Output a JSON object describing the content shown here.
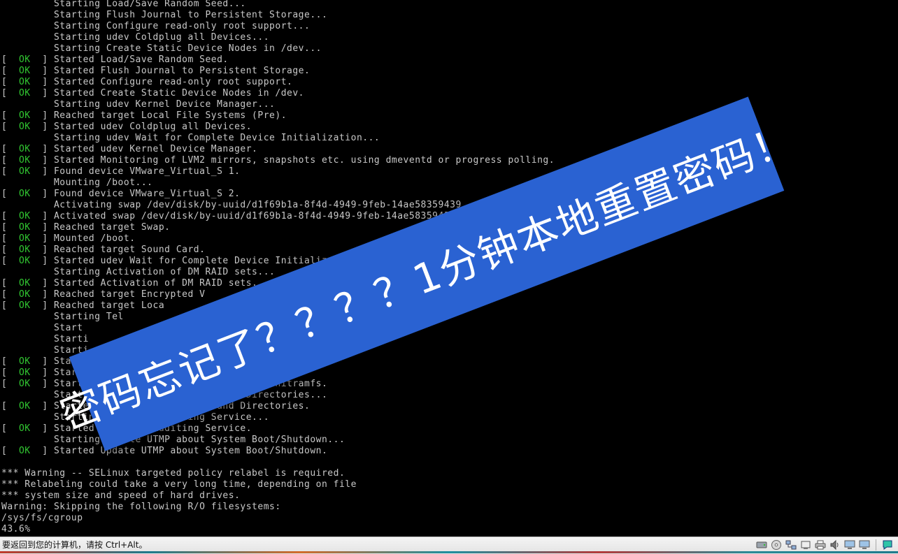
{
  "console": {
    "lines": [
      {
        "ok": false,
        "text": "Starting Load/Save Random Seed..."
      },
      {
        "ok": false,
        "text": "Starting Flush Journal to Persistent Storage..."
      },
      {
        "ok": false,
        "text": "Starting Configure read-only root support..."
      },
      {
        "ok": false,
        "text": "Starting udev Coldplug all Devices..."
      },
      {
        "ok": false,
        "text": "Starting Create Static Device Nodes in /dev..."
      },
      {
        "ok": true,
        "text": "Started Load/Save Random Seed."
      },
      {
        "ok": true,
        "text": "Started Flush Journal to Persistent Storage."
      },
      {
        "ok": true,
        "text": "Started Configure read-only root support."
      },
      {
        "ok": true,
        "text": "Started Create Static Device Nodes in /dev."
      },
      {
        "ok": false,
        "text": "Starting udev Kernel Device Manager..."
      },
      {
        "ok": true,
        "text": "Reached target Local File Systems (Pre)."
      },
      {
        "ok": true,
        "text": "Started udev Coldplug all Devices."
      },
      {
        "ok": false,
        "text": "Starting udev Wait for Complete Device Initialization..."
      },
      {
        "ok": true,
        "text": "Started udev Kernel Device Manager."
      },
      {
        "ok": true,
        "text": "Started Monitoring of LVM2 mirrors, snapshots etc. using dmeventd or progress polling."
      },
      {
        "ok": true,
        "text": "Found device VMware_Virtual_S 1."
      },
      {
        "ok": false,
        "text": "Mounting /boot..."
      },
      {
        "ok": true,
        "text": "Found device VMware_Virtual_S 2."
      },
      {
        "ok": false,
        "text": "Activating swap /dev/disk/by-uuid/d1f69b1a-8f4d-4949-9feb-14ae58359439..."
      },
      {
        "ok": true,
        "text": "Activated swap /dev/disk/by-uuid/d1f69b1a-8f4d-4949-9feb-14ae58359439."
      },
      {
        "ok": true,
        "text": "Reached target Swap."
      },
      {
        "ok": true,
        "text": "Mounted /boot."
      },
      {
        "ok": true,
        "text": "Reached target Sound Card."
      },
      {
        "ok": true,
        "text": "Started udev Wait for Complete Device Initializa"
      },
      {
        "ok": false,
        "text": "Starting Activation of DM RAID sets..."
      },
      {
        "ok": true,
        "text": "Started Activation of DM RAID sets."
      },
      {
        "ok": true,
        "text": "Reached target Encrypted V"
      },
      {
        "ok": true,
        "text": "Reached target Loca"
      },
      {
        "ok": false,
        "text": "Starting Tel"
      },
      {
        "ok": false,
        "text": "Start"
      },
      {
        "ok": false,
        "text": "Starti"
      },
      {
        "ok": false,
        "text": "Starti"
      },
      {
        "ok": true,
        "text": "Started"
      },
      {
        "ok": true,
        "text": "Started                     ime Data."
      },
      {
        "ok": true,
        "text": "Started                   ation from initramfs."
      },
      {
        "ok": false,
        "text": "Starting               Files and Directories..."
      },
      {
        "ok": true,
        "text": "Started C      latile Files and Directories."
      },
      {
        "ok": false,
        "text": "Starting Security Auditing Service..."
      },
      {
        "ok": true,
        "text": "Started Security Auditing Service."
      },
      {
        "ok": false,
        "text": "Starting Update UTMP about System Boot/Shutdown..."
      },
      {
        "ok": true,
        "text": "Started Update UTMP about System Boot/Shutdown."
      },
      {
        "ok": null,
        "text": ""
      },
      {
        "ok": null,
        "text": "*** Warning -- SELinux targeted policy relabel is required."
      },
      {
        "ok": null,
        "text": "*** Relabeling could take a very long time, depending on file"
      },
      {
        "ok": null,
        "text": "*** system size and speed of hard drives."
      },
      {
        "ok": null,
        "text": "Warning: Skipping the following R/O filesystems:"
      },
      {
        "ok": null,
        "text": "/sys/fs/cgroup"
      },
      {
        "ok": null,
        "text": "43.6%"
      }
    ]
  },
  "banner": {
    "text": "密码忘记了？？？？1分钟本地重置密码！"
  },
  "statusbar": {
    "text": "要返回到您的计算机，请按 Ctrl+Alt。"
  },
  "tray": {
    "icons": [
      "hard-disk-icon",
      "cd-drive-icon",
      "network-icon",
      "usb-device-icon",
      "printer-icon",
      "sound-icon",
      "display-icon",
      "display-icon-2",
      "message-icon"
    ]
  },
  "colors": {
    "ok_green": "#31c831",
    "console_text": "#c8c8c8",
    "banner_blue": "#2a62d2"
  }
}
